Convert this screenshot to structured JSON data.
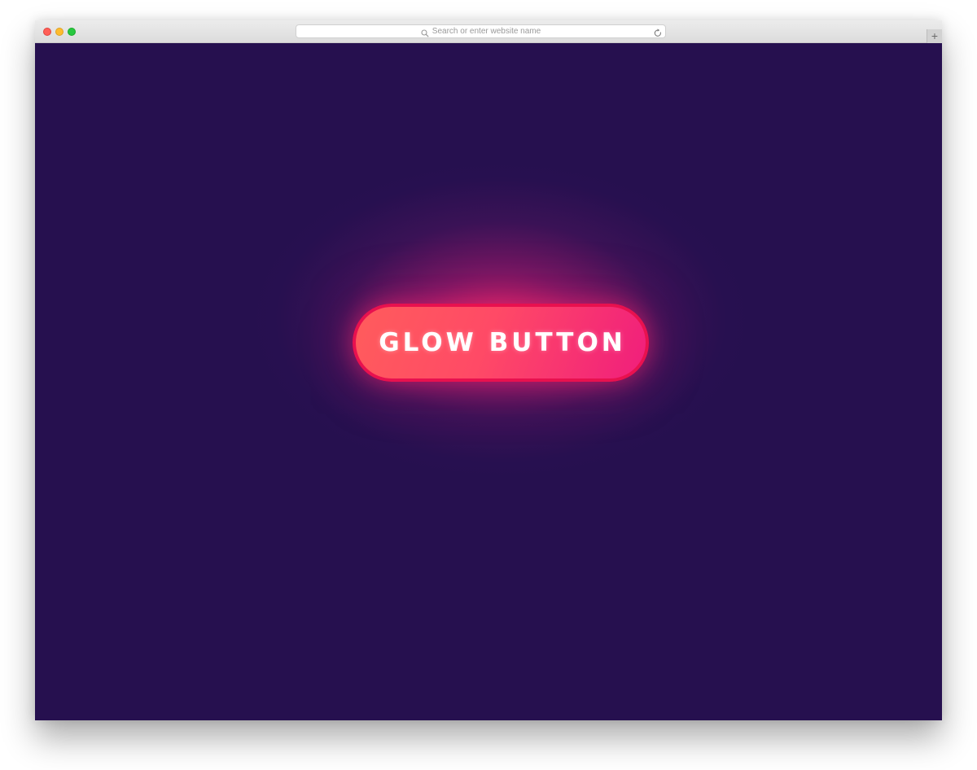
{
  "browser": {
    "address_bar": {
      "placeholder": "Search or enter website name",
      "search_icon": "search-icon",
      "reload_icon": "reload-icon"
    },
    "traffic_lights": {
      "close_color": "#ff5f57",
      "minimize_color": "#febc2e",
      "zoom_color": "#28c840"
    },
    "new_tab_label": "+"
  },
  "page": {
    "background_color": "#26104f",
    "button": {
      "label": "GLOW BUTTON",
      "gradient_start": "#ff5c5c",
      "gradient_end": "#f01e7c",
      "border_color": "#e8114f",
      "glow_color": "#ff286e"
    }
  }
}
